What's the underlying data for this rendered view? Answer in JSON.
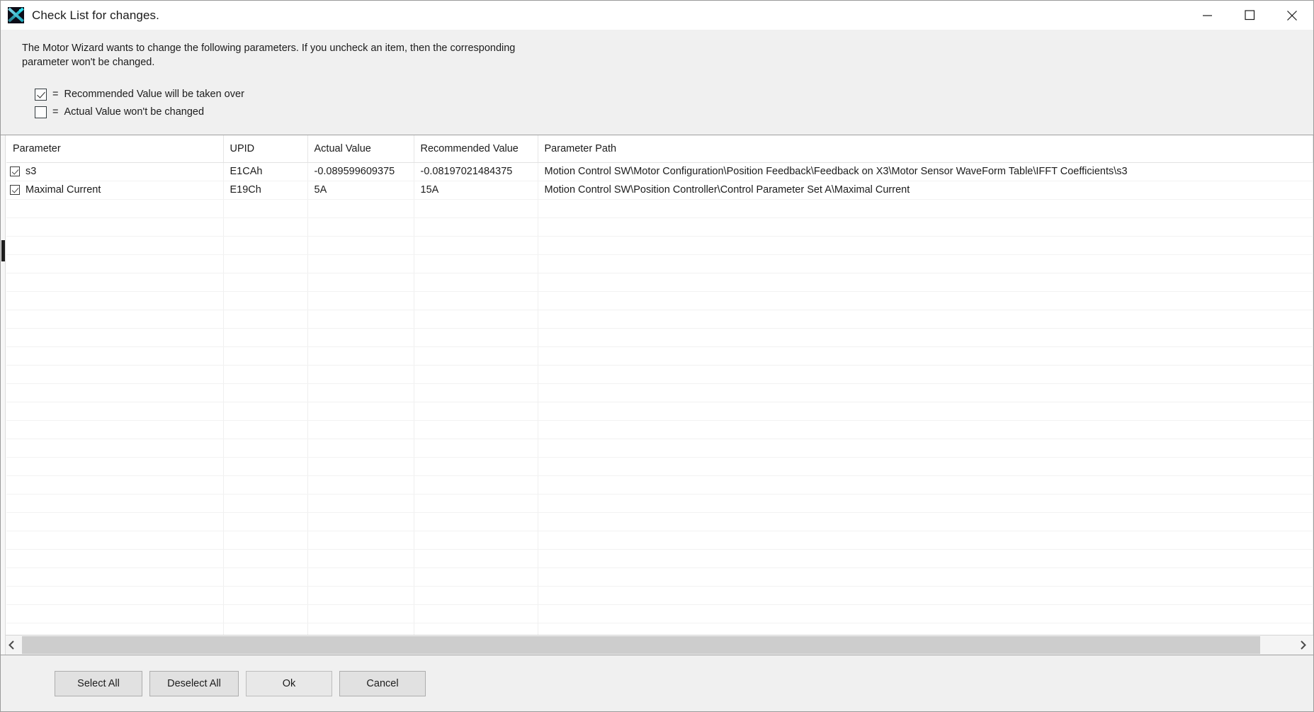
{
  "window": {
    "title": "Check List for changes.",
    "icon": "app-x-icon",
    "controls": {
      "minimize": "minimize-icon",
      "maximize": "maximize-icon",
      "close": "close-icon"
    }
  },
  "instructions": {
    "line1": "The Motor Wizard wants to change the following parameters. If you uncheck an item, then the corresponding",
    "line2": "parameter won't be changed."
  },
  "legend": [
    {
      "checked": true,
      "equals": "=",
      "text": "Recommended Value will be taken over"
    },
    {
      "checked": false,
      "equals": "=",
      "text": "Actual Value won't be changed"
    }
  ],
  "table": {
    "columns": [
      "Parameter",
      "UPID",
      "Actual Value",
      "Recommended Value",
      "Parameter Path"
    ],
    "rows": [
      {
        "checked": true,
        "parameter": "s3",
        "upid": "E1CAh",
        "actual_value": "-0.089599609375",
        "recommended_value": "-0.08197021484375",
        "parameter_path": "Motion Control SW\\Motor Configuration\\Position Feedback\\Feedback on X3\\Motor Sensor WaveForm Table\\IFFT Coefficients\\s3"
      },
      {
        "checked": true,
        "parameter": "Maximal Current",
        "upid": "E19Ch",
        "actual_value": "5A",
        "recommended_value": "15A",
        "parameter_path": "Motion Control SW\\Position Controller\\Control Parameter Set A\\Maximal Current"
      }
    ],
    "empty_row_count": 25
  },
  "scrollbar": {
    "left_arrow": "chevron-left-icon",
    "right_arrow": "chevron-right-icon"
  },
  "footer": {
    "select_all": "Select All",
    "deselect_all": "Deselect All",
    "ok": "Ok",
    "cancel": "Cancel"
  },
  "colors": {
    "dialog_bg": "#f0f0f0",
    "table_bg": "#ffffff",
    "icon_accent": "#1fd8e8",
    "button_bg": "#e1e1e1"
  }
}
